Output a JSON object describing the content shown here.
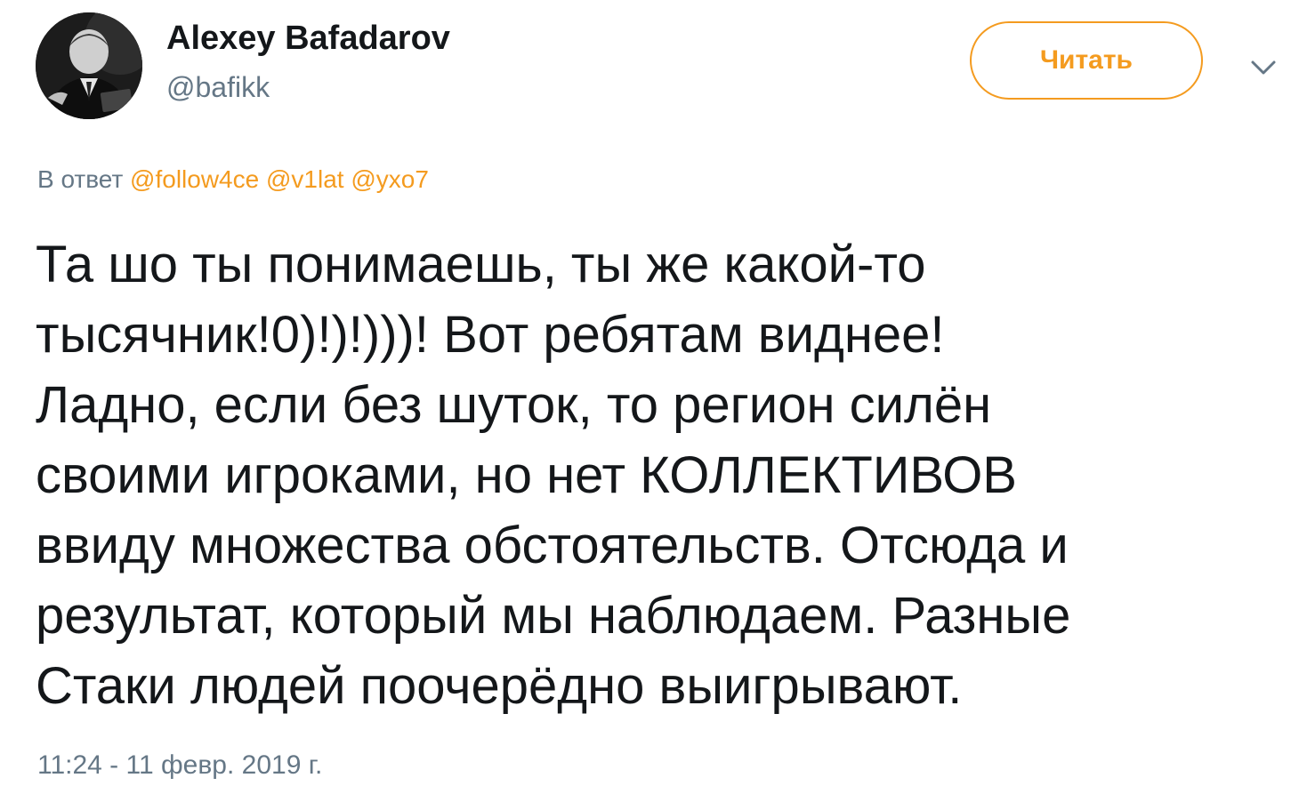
{
  "author": {
    "name": "Alexey Bafadarov",
    "handle": "@bafikk",
    "avatar_icon": "user-avatar-photo"
  },
  "follow_button": {
    "label": "Читать"
  },
  "menu": {
    "icon": "chevron-down-icon"
  },
  "reply": {
    "prefix": "В ответ",
    "mentions": [
      "@follow4ce",
      "@v1lat",
      "@yxo7"
    ]
  },
  "tweet": {
    "lines": [
      "Та шо ты понимаешь, ты же какой-то",
      "тысячник!0)!)!)))! Вот ребятам виднее!",
      "Ладно, если без шуток, то регион силён",
      "своими игроками, но нет КОЛЛЕКТИВОВ",
      "ввиду множества обстоятельств. Отсюда и",
      "результат, который мы наблюдаем. Разные",
      "Стаки людей поочерёдно выигрывают."
    ],
    "timestamp": "11:24 - 11 февр. 2019 г."
  },
  "colors": {
    "accent": "#f49b1f",
    "text": "#14171a",
    "muted": "#657786",
    "background": "#ffffff"
  }
}
